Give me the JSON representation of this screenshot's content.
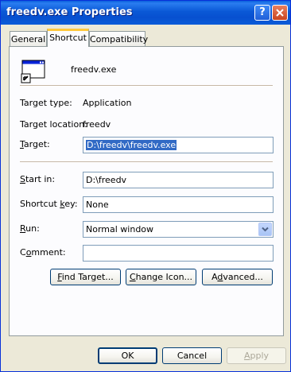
{
  "window": {
    "title": "freedv.exe Properties",
    "help_glyph": "?",
    "close_icon": "close-icon"
  },
  "tabs": [
    {
      "label": "General"
    },
    {
      "label": "Shortcut"
    },
    {
      "label": "Compatibility"
    }
  ],
  "shortcut": {
    "file_name": "freedv.exe",
    "target_type_label": "Target type:",
    "target_type_value": "Application",
    "target_location_label": "Target location:",
    "target_location_value": "freedv",
    "target_label_pre": "",
    "target_label_key": "T",
    "target_label_post": "arget:",
    "target_value": "D:\\freedv\\freedv.exe",
    "start_in_label_key": "S",
    "start_in_label_post": "tart in:",
    "start_in_value": "D:\\freedv",
    "shortcut_key_label_pre": "Shortcut ",
    "shortcut_key_label_key": "k",
    "shortcut_key_label_post": "ey:",
    "shortcut_key_value": "None",
    "run_label_key": "R",
    "run_label_post": "un:",
    "run_value": "Normal window",
    "comment_label_pre": "C",
    "comment_label_key": "o",
    "comment_label_post": "mment:",
    "comment_value": "",
    "find_target_pre": "",
    "find_target_key": "F",
    "find_target_post": "ind Target...",
    "change_icon_pre": "",
    "change_icon_key": "C",
    "change_icon_post": "hange Icon...",
    "advanced_pre": "A",
    "advanced_key": "d",
    "advanced_post": "vanced..."
  },
  "footer": {
    "ok_label": "OK",
    "cancel_label": "Cancel",
    "apply_label_key": "A",
    "apply_label_post": "pply"
  },
  "colors": {
    "titlebar": "#0a58d6",
    "selection": "#316ac5",
    "tab_highlight": "#ffc83c"
  }
}
